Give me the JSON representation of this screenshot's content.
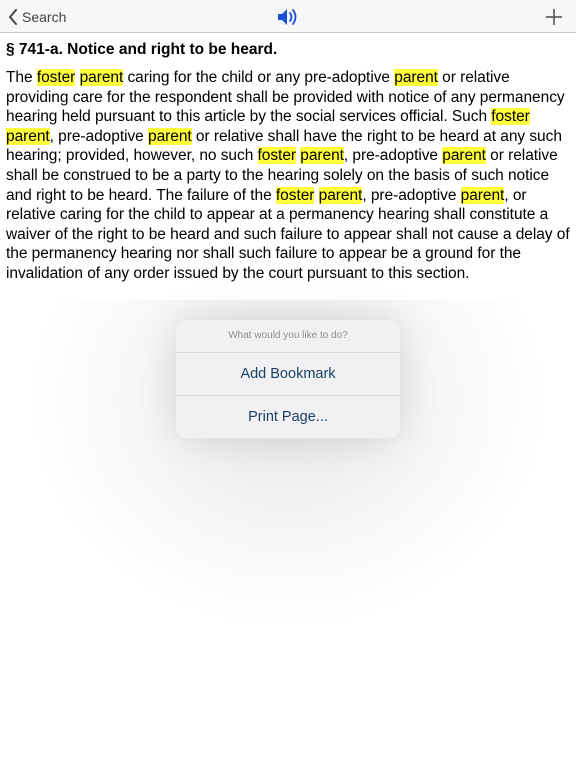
{
  "navbar": {
    "back_label": "Search",
    "back_icon": "chevron-left-icon",
    "speaker_icon": "speaker-icon",
    "add_icon": "plus-icon",
    "accent_color": "#1a4fd6"
  },
  "section": {
    "heading": "§ 741-a. Notice and right to be heard.",
    "highlight_color": "#ffff3b",
    "paragraph": [
      {
        "t": "The "
      },
      {
        "t": "foster",
        "hl": true
      },
      {
        "t": " "
      },
      {
        "t": "parent",
        "hl": true
      },
      {
        "t": " caring for the child or any pre-adoptive "
      },
      {
        "t": "parent",
        "hl": true
      },
      {
        "t": " or relative providing care for the respondent shall be provided with notice of any permanency hearing held pursuant to this article by the social services official. Such "
      },
      {
        "t": "foster",
        "hl": true
      },
      {
        "t": " "
      },
      {
        "t": "parent",
        "hl": true
      },
      {
        "t": ", pre-adoptive "
      },
      {
        "t": "parent",
        "hl": true
      },
      {
        "t": " or relative shall have the right to be heard at any such hearing; provided, however, no such "
      },
      {
        "t": "foster",
        "hl": true
      },
      {
        "t": " "
      },
      {
        "t": "parent",
        "hl": true
      },
      {
        "t": ", pre-adoptive "
      },
      {
        "t": "parent",
        "hl": true
      },
      {
        "t": " or relative shall be construed to be a party to the hearing solely on the basis of such notice and right to be heard. The failure of the "
      },
      {
        "t": "foster",
        "hl": true
      },
      {
        "t": " "
      },
      {
        "t": "parent",
        "hl": true
      },
      {
        "t": ", pre-adoptive "
      },
      {
        "t": "parent",
        "hl": true
      },
      {
        "t": ", or relative caring for the child to appear at a permanency hearing shall constitute a waiver of the right to be heard and such failure to appear shall not cause a delay of the permanency hearing nor shall such failure to appear be a ground for the invalidation of any order issued by the court pursuant to this section."
      }
    ]
  },
  "popover": {
    "title": "What would you like to do?",
    "items": [
      {
        "label": "Add Bookmark"
      },
      {
        "label": "Print Page..."
      }
    ]
  }
}
